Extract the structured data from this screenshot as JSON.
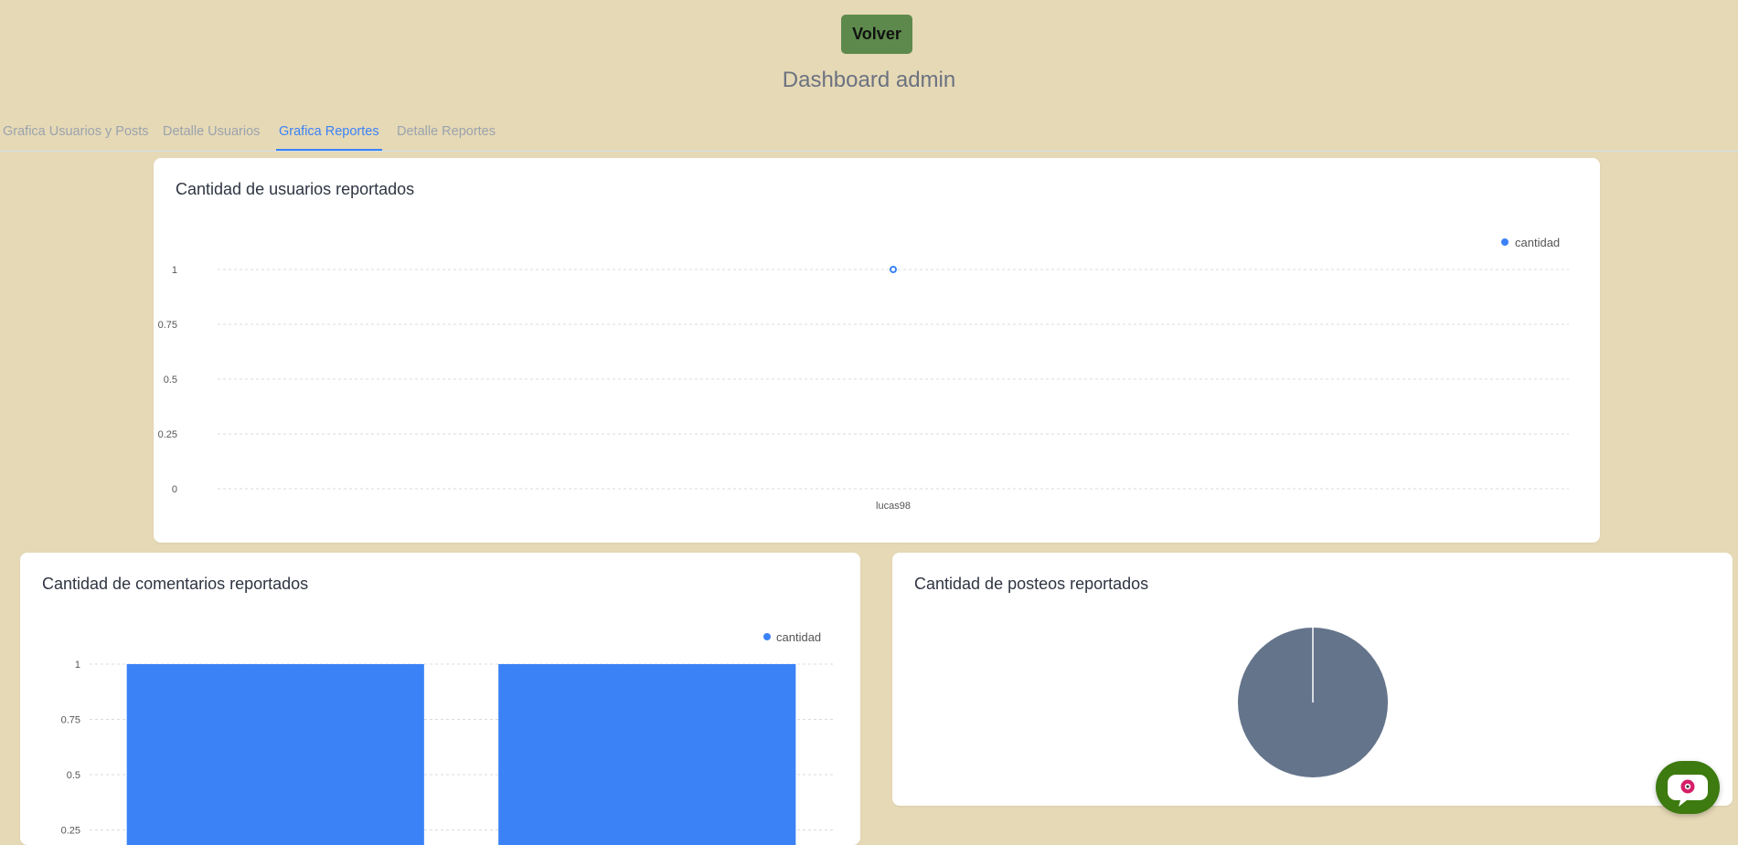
{
  "header": {
    "back_label": "Volver",
    "title": "Dashboard admin"
  },
  "tabs": [
    {
      "label": "Grafica Usuarios y Posts",
      "active": false
    },
    {
      "label": "Detalle Usuarios",
      "active": false
    },
    {
      "label": "Grafica Reportes",
      "active": true
    },
    {
      "label": "Detalle Reportes",
      "active": false
    }
  ],
  "colors": {
    "background": "#e6d9b6",
    "primary_button": "#5d8a4c",
    "tab_active": "#3b82f6",
    "series": "#3b82f6",
    "pie": "#64748b",
    "chat_button": "#3d7a0f"
  },
  "chat": {
    "icon": "chatbot-icon"
  },
  "chart_data": [
    {
      "type": "line",
      "title": "Cantidad de usuarios reportados",
      "categories": [
        "lucas98"
      ],
      "series": [
        {
          "name": "cantidad",
          "values": [
            1
          ]
        }
      ],
      "ylim": [
        0,
        1
      ],
      "yticks": [
        "0",
        "0.25",
        "0.5",
        "0.75",
        "1"
      ],
      "grid": true,
      "legend": "top-right"
    },
    {
      "type": "bar",
      "title": "Cantidad de comentarios reportados",
      "categories": [
        "",
        ""
      ],
      "series": [
        {
          "name": "cantidad",
          "values": [
            1,
            1
          ]
        }
      ],
      "ylim": [
        0,
        1
      ],
      "yticks": [
        "0.25",
        "0.5",
        "0.75",
        "1"
      ],
      "grid": true,
      "legend": "top-right"
    },
    {
      "type": "pie",
      "title": "Cantidad de posteos reportados",
      "slices": [
        {
          "value": 1
        }
      ]
    }
  ]
}
